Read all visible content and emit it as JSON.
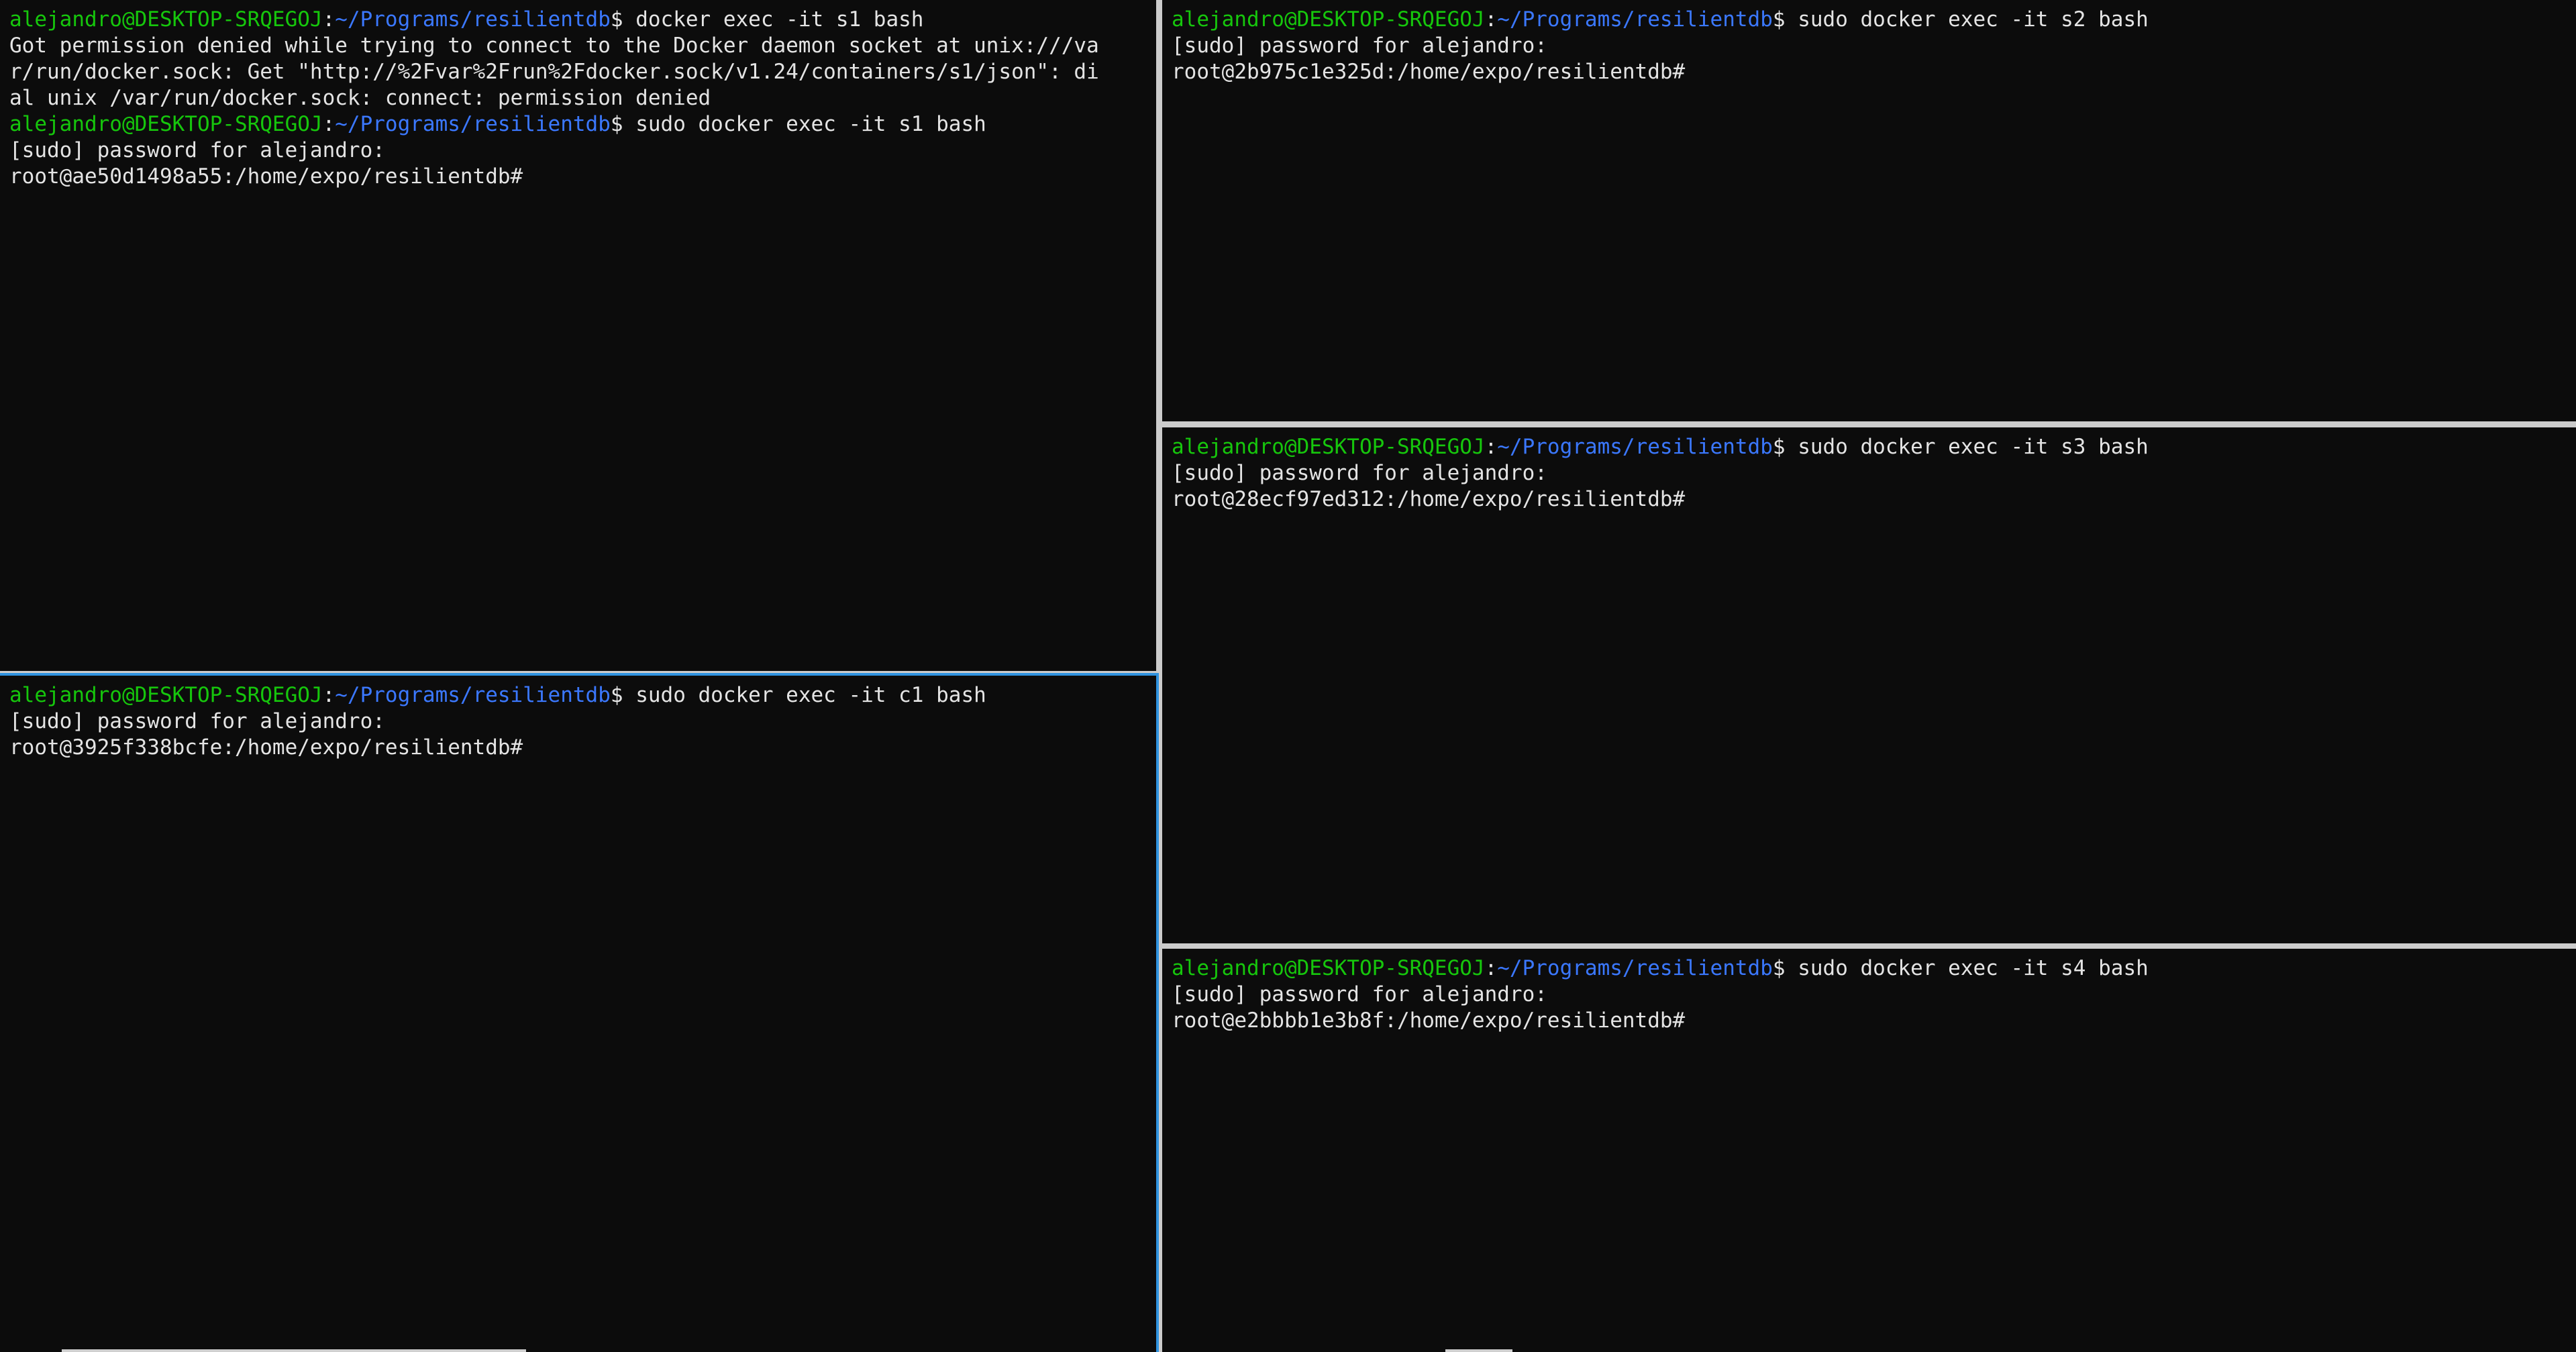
{
  "prompt": {
    "user_host": "alejandro@DESKTOP-SRQEGOJ",
    "colon": ":",
    "path": "~/Programs/resilientdb",
    "dollar": "$ "
  },
  "panes": {
    "top_left": {
      "cmd1": "docker exec -it s1 bash",
      "err1": "Got permission denied while trying to connect to the Docker daemon socket at unix:///va",
      "err2": "r/run/docker.sock: Get \"http://%2Fvar%2Frun%2Fdocker.sock/v1.24/containers/s1/json\": di",
      "err3": "al unix /var/run/docker.sock: connect: permission denied",
      "cmd2": "sudo docker exec -it s1 bash",
      "sudo": "[sudo] password for alejandro:",
      "root": "root@ae50d1498a55:/home/expo/resilientdb#"
    },
    "bottom_left": {
      "cmd": "sudo docker exec -it c1 bash",
      "sudo": "[sudo] password for alejandro:",
      "root": "root@3925f338bcfe:/home/expo/resilientdb#"
    },
    "top_right": {
      "cmd": "sudo docker exec -it s2 bash",
      "sudo": "[sudo] password for alejandro:",
      "root": "root@2b975c1e325d:/home/expo/resilientdb#"
    },
    "middle_right": {
      "cmd": "sudo docker exec -it s3 bash",
      "sudo": "[sudo] password for alejandro:",
      "root": "root@28ecf97ed312:/home/expo/resilientdb#"
    },
    "bottom_right": {
      "cmd": "sudo docker exec -it s4 bash",
      "sudo": "[sudo] password for alejandro:",
      "root": "root@e2bbbb1e3b8f:/home/expo/resilientdb#"
    }
  },
  "colors": {
    "background": "#0c0c0c",
    "text": "#e4e4e4",
    "user_host": "#16c60c",
    "path": "#3b78ff",
    "divider": "#cccccc",
    "active_border": "#2f93e0"
  }
}
